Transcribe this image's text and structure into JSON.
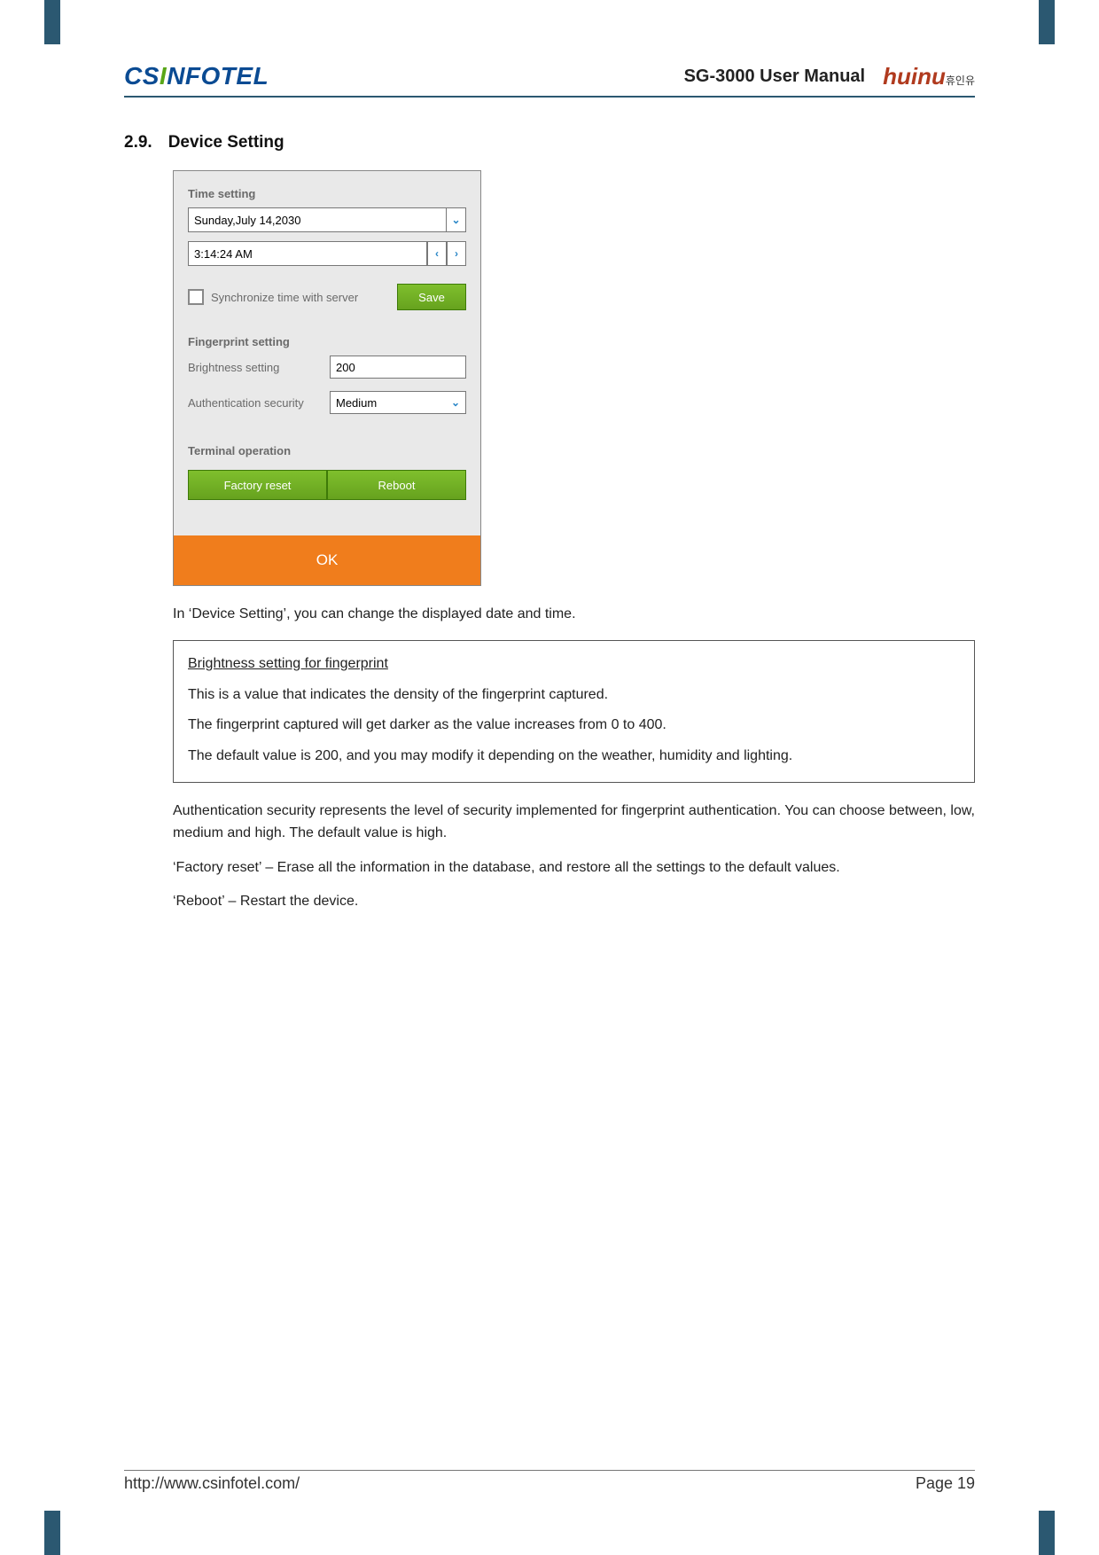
{
  "header": {
    "logo_left_cs": "CS",
    "logo_left_i": "I",
    "logo_left_rest": "NFOTEL",
    "manual_title": "SG-3000 User Manual",
    "logo_right_main": "huinu",
    "logo_right_kr": "휴인유"
  },
  "section": {
    "number": "2.9.",
    "title": "Device Setting"
  },
  "figure": {
    "time_setting_title": "Time setting",
    "date_value": "Sunday,July 14,2030",
    "time_value": " 3:14:24 AM",
    "sync_label": "Synchronize time with server",
    "save_label": "Save",
    "fp_title": "Fingerprint setting",
    "brightness_label": "Brightness setting",
    "brightness_value": "200",
    "auth_label": "Authentication security",
    "auth_value": "Medium",
    "term_title": "Terminal operation",
    "factory_reset_label": "Factory reset",
    "reboot_label": "Reboot",
    "ok_label": "OK"
  },
  "body": {
    "intro": "In ‘Device Setting’, you can change the displayed date and time.",
    "box_title": "Brightness setting for fingerprint",
    "box_p1": "This is a value that indicates the density of the fingerprint captured.",
    "box_p2": "The fingerprint captured will get darker as the value increases from 0 to 400.",
    "box_p3": "The default value is 200, and you may modify it depending on the weather, humidity and lighting.",
    "auth_para": "Authentication security represents the level of security implemented for fingerprint authentication. You can choose between, low, medium and high. The default value is high.",
    "factory_para": "‘Factory reset’ – Erase all the information in the database, and restore all the settings to the default values.",
    "reboot_para": "‘Reboot’ – Restart the device."
  },
  "footer": {
    "url": "http://www.csinfotel.com/",
    "page": "Page 19"
  }
}
